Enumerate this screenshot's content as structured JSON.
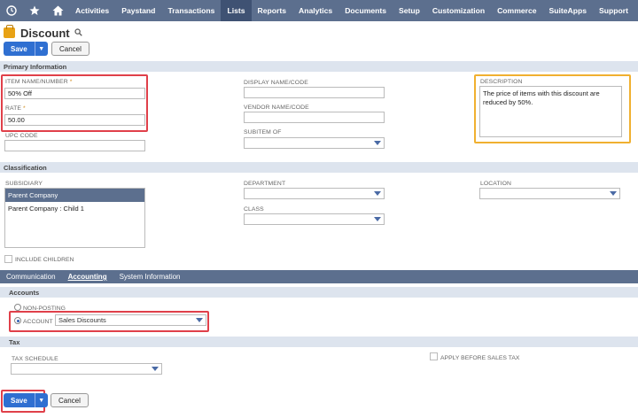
{
  "nav": {
    "items": [
      "Activities",
      "Paystand",
      "Transactions",
      "Lists",
      "Reports",
      "Analytics",
      "Documents",
      "Setup",
      "Customization",
      "Commerce",
      "SuiteApps",
      "Support"
    ],
    "active": "Lists"
  },
  "page": {
    "title": "Discount"
  },
  "buttons": {
    "save": "Save",
    "cancel": "Cancel",
    "dropdown_glyph": "▼"
  },
  "sections": {
    "primary": "Primary Information",
    "classification": "Classification",
    "accounts": "Accounts",
    "tax": "Tax"
  },
  "primary": {
    "item_name_label": "ITEM NAME/NUMBER",
    "item_name_value": "50% Off",
    "rate_label": "RATE",
    "rate_value": "50.00",
    "upc_label": "UPC CODE",
    "display_name_label": "DISPLAY NAME/CODE",
    "vendor_name_label": "VENDOR NAME/CODE",
    "subitem_label": "SUBITEM OF",
    "description_label": "DESCRIPTION",
    "description_value": "The price of items with this discount are reduced by 50%.",
    "required_mark": "*"
  },
  "classification": {
    "subsidiary_label": "SUBSIDIARY",
    "subsidiary_options": [
      "Parent Company",
      "Parent Company : Child 1"
    ],
    "include_children_label": "INCLUDE CHILDREN",
    "department_label": "DEPARTMENT",
    "class_label": "CLASS",
    "location_label": "LOCATION"
  },
  "subtabs": {
    "communication": "Communication",
    "accounting": "Accounting",
    "system_information": "System Information"
  },
  "accounts": {
    "non_posting_label": "NON-POSTING",
    "account_label": "ACCOUNT",
    "account_value": "Sales Discounts"
  },
  "tax": {
    "tax_schedule_label": "TAX SCHEDULE",
    "apply_before_label": "APPLY BEFORE SALES TAX"
  },
  "colors": {
    "nav_bg": "#5c6f8e",
    "primary_button": "#2f6fd1",
    "highlight_red": "#e0404a",
    "highlight_orange": "#f0b030"
  }
}
